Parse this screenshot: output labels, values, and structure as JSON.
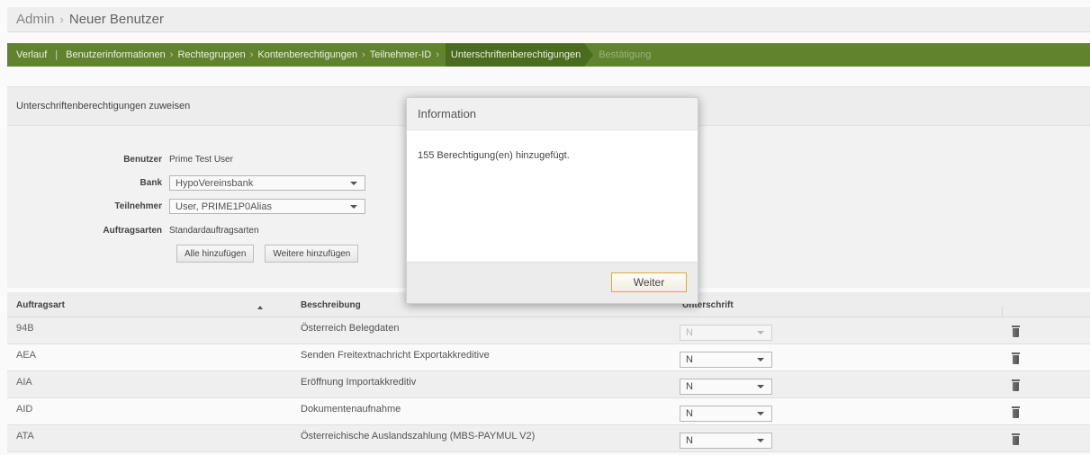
{
  "header": {
    "admin": "Admin",
    "separator": "›",
    "current": "Neuer Benutzer"
  },
  "wizard": {
    "history": "Verlauf",
    "bar": "|",
    "chevron": "›",
    "steps": [
      "Benutzerinformationen",
      "Rechtegruppen",
      "Kontenberechtigungen",
      "Teilnehmer-ID"
    ],
    "active": "Unterschriftenberechtigungen",
    "next": "Bestätigung"
  },
  "section": {
    "title": "Unterschriftenberechtigungen zuweisen"
  },
  "form": {
    "user_label": "Benutzer",
    "user_value": "Prime Test User",
    "bank_label": "Bank",
    "bank_value": "HypoVereinsbank",
    "participant_label": "Teilnehmer",
    "participant_value": "User, PRIME1P0Alias",
    "order_types_label": "Auftragsarten",
    "order_types_value": "Standardauftragsarten",
    "add_all": "Alle hinzufügen",
    "add_more": "Weitere hinzufügen"
  },
  "table": {
    "col_order_type": "Auftragsart",
    "col_description": "Beschreibung",
    "col_signature": "Unterschrift",
    "rows": [
      {
        "code": "94B",
        "description": "Österreich Belegdaten",
        "signature": "N"
      },
      {
        "code": "AEA",
        "description": "Senden Freitextnachricht Exportakkreditive",
        "signature": "N"
      },
      {
        "code": "AIA",
        "description": "Eröffnung Importakkreditiv",
        "signature": "N"
      },
      {
        "code": "AID",
        "description": "Dokumentenaufnahme",
        "signature": "N"
      },
      {
        "code": "ATA",
        "description": "Österreichische Auslandszahlung (MBS-PAYMUL V2)",
        "signature": "N"
      }
    ]
  },
  "modal": {
    "title": "Information",
    "message": "155 Berechtigung(en) hinzugefügt.",
    "button": "Weiter"
  },
  "colors": {
    "wizard_green": "#63862f",
    "active_step": "#4d6e1f",
    "modal_button_border": "#e0a832"
  }
}
